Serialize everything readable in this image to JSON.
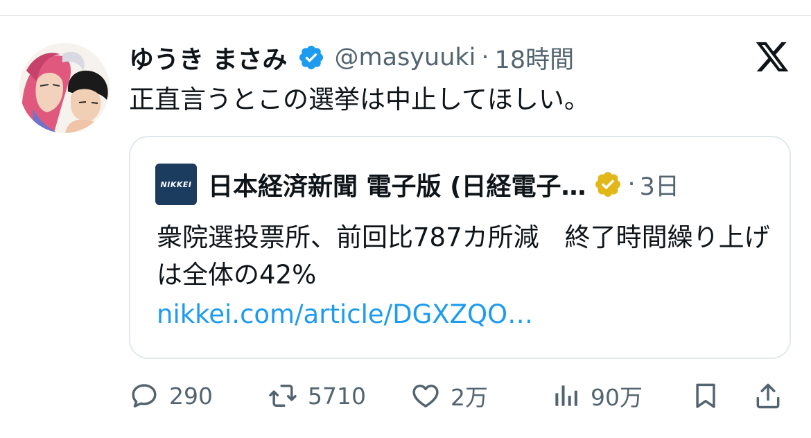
{
  "tweet": {
    "display_name": "ゆうき まさみ",
    "handle": "@masyuuki",
    "separator": "·",
    "time": "18時間",
    "text": "正直言うとこの選挙は中止してほしい。"
  },
  "quote": {
    "logo_text": "NIKKEI",
    "name": "日本経済新聞 電子版 (日経電子…",
    "separator": "·",
    "time": "3日",
    "body": "衆院選投票所、前回比787カ所減　終了時間繰り上げは全体の42%",
    "link": "nikkei.com/article/DGXZQO…"
  },
  "actions": {
    "replies": "290",
    "retweets": "5710",
    "likes": "2万",
    "views": "90万"
  },
  "icons": {
    "verified": "verified-badge-icon",
    "gold_verified": "gold-verified-badge-icon",
    "logo": "x-logo-icon",
    "reply": "reply-icon",
    "retweet": "retweet-icon",
    "like": "heart-icon",
    "views": "views-icon",
    "bookmark": "bookmark-icon",
    "share": "share-icon"
  },
  "colors": {
    "text": "#0f1419",
    "muted": "#536471",
    "link": "#1d9bf0",
    "verified_blue": "#1d9bf0",
    "verified_gold": "#e2b719",
    "nikkei_navy": "#1b3b5f",
    "border": "#e1e8ed"
  }
}
